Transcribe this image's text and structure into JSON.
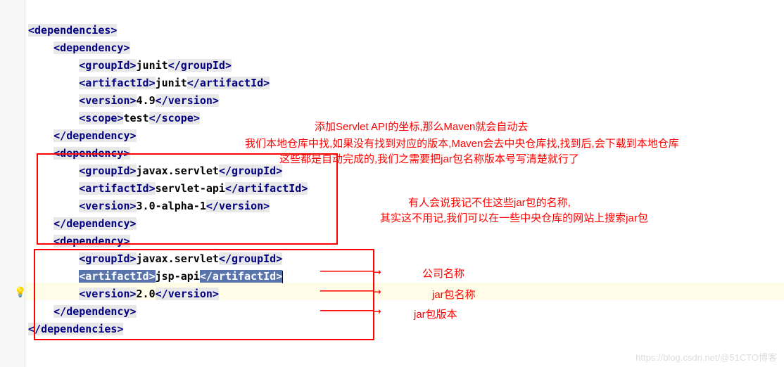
{
  "xml": {
    "open_deps": "dependencies",
    "close_deps": "dependencies",
    "dep": "dependency",
    "gid": "groupId",
    "aid": "artifactId",
    "ver": "version",
    "scope": "scope",
    "d1": {
      "gid": "junit",
      "aid": "junit",
      "ver": "4.9",
      "scope": "test"
    },
    "d2": {
      "gid": "javax.servlet",
      "aid": "servlet-api",
      "ver": "3.0-alpha-1"
    },
    "d3": {
      "gid": "javax.servlet",
      "aid": "jsp-api",
      "ver": "2.0"
    }
  },
  "ann": {
    "block1_l1": "添加Servlet API的坐标,那么Maven就会自动去",
    "block1_l2": "我们本地仓库中找,如果没有找到对应的版本,Maven会去中央仓库找,找到后,会下载到本地仓库",
    "block1_l3": "这些都是自动完成的,我们之需要把jar包名称版本号写清楚就行了",
    "block2_l1": "有人会说我记不住这些jar包的名称,",
    "block2_l2": "其实这不用记,我们可以在一些中央仓库的网站上搜索jar包",
    "company": "公司名称",
    "jarname": "jar包名称",
    "jarver": "jar包版本"
  },
  "watermark": "https://blog.csdn.net/@51CTO博客"
}
